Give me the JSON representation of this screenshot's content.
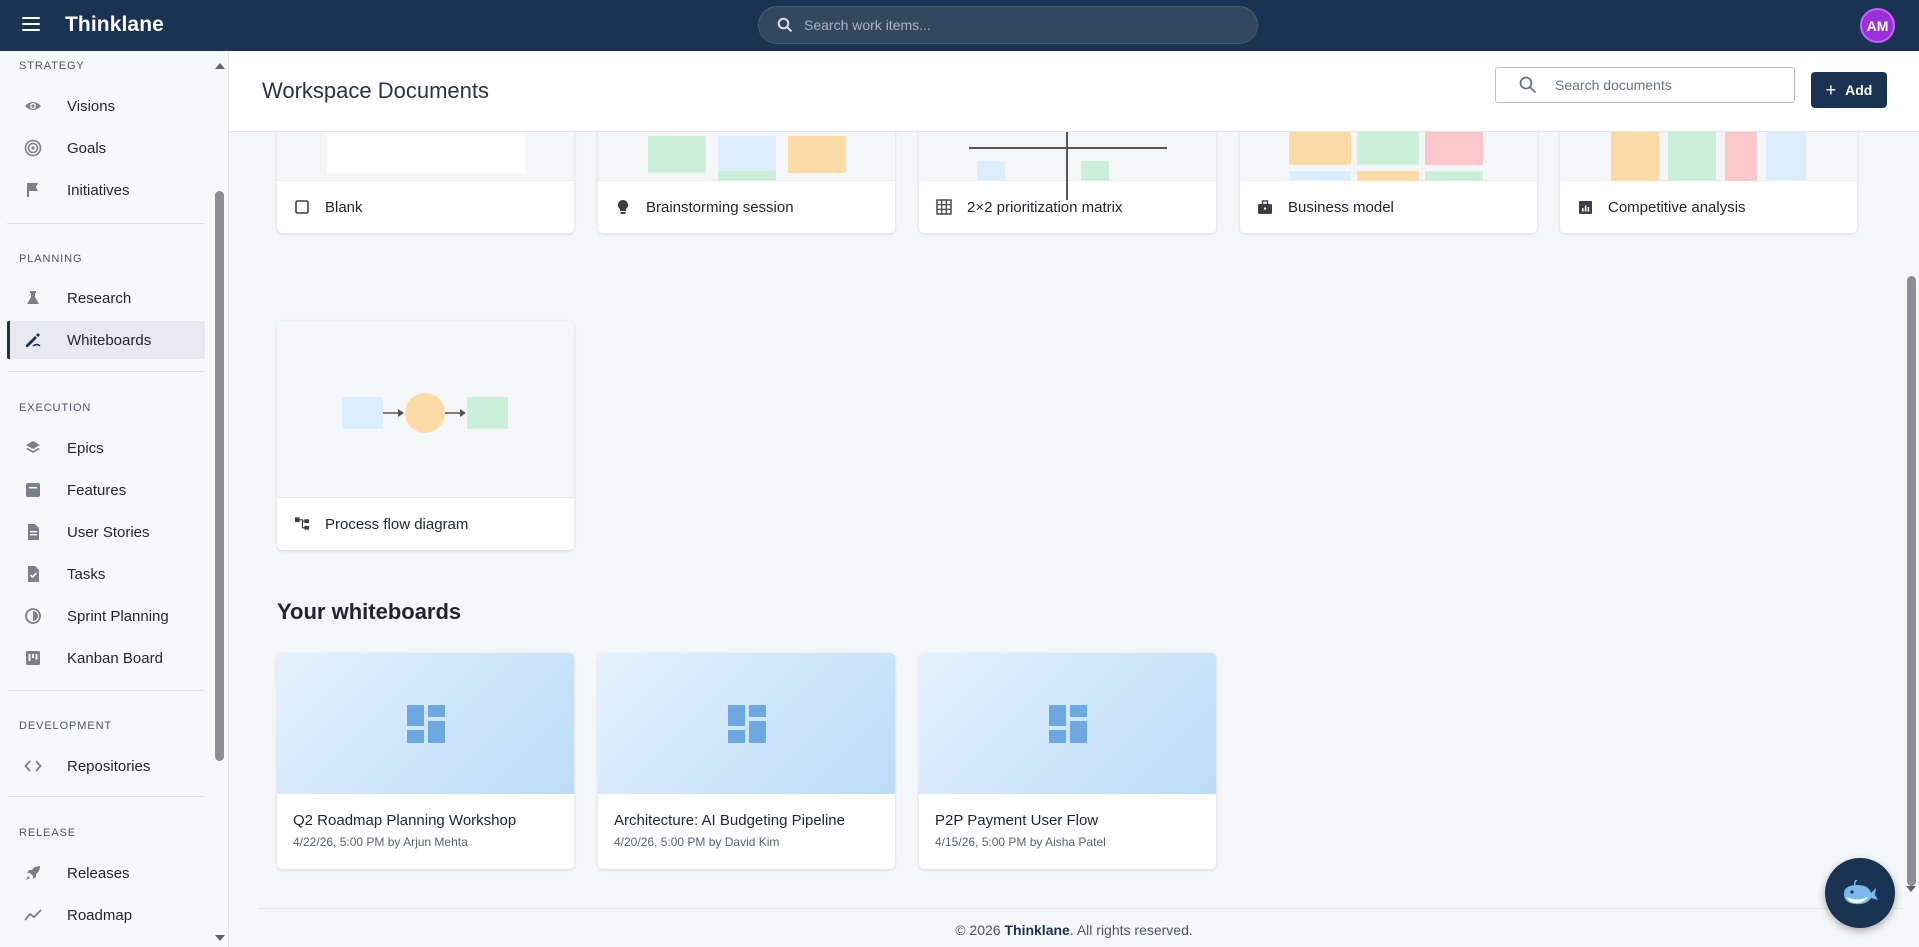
{
  "topbar": {
    "brand": "Thinklane",
    "search_placeholder": "Search work items...",
    "avatar_initials": "AM"
  },
  "sidebar": {
    "sections": [
      {
        "title": "STRATEGY",
        "items": [
          {
            "label": "Visions",
            "icon": "eye-icon"
          },
          {
            "label": "Goals",
            "icon": "target-icon"
          },
          {
            "label": "Initiatives",
            "icon": "flag-icon"
          }
        ]
      },
      {
        "title": "PLANNING",
        "items": [
          {
            "label": "Research",
            "icon": "flask-icon"
          },
          {
            "label": "Whiteboards",
            "icon": "draw-icon",
            "active": true
          }
        ]
      },
      {
        "title": "EXECUTION",
        "items": [
          {
            "label": "Epics",
            "icon": "layers-icon"
          },
          {
            "label": "Features",
            "icon": "feature-icon"
          },
          {
            "label": "User Stories",
            "icon": "document-icon"
          },
          {
            "label": "Tasks",
            "icon": "task-icon"
          },
          {
            "label": "Sprint Planning",
            "icon": "sprint-icon"
          },
          {
            "label": "Kanban Board",
            "icon": "kanban-icon"
          }
        ]
      },
      {
        "title": "DEVELOPMENT",
        "items": [
          {
            "label": "Repositories",
            "icon": "code-icon"
          }
        ]
      },
      {
        "title": "RELEASE",
        "items": [
          {
            "label": "Releases",
            "icon": "rocket-icon"
          },
          {
            "label": "Roadmap",
            "icon": "trend-icon"
          }
        ]
      }
    ]
  },
  "header": {
    "title": "Workspace Documents",
    "search_placeholder": "Search documents",
    "add_label": "Add"
  },
  "templates": [
    {
      "label": "Blank",
      "icon": "square-icon"
    },
    {
      "label": "Brainstorming session",
      "icon": "lightbulb-icon"
    },
    {
      "label": "2×2 prioritization matrix",
      "icon": "grid-icon"
    },
    {
      "label": "Business model",
      "icon": "briefcase-icon"
    },
    {
      "label": "Competitive analysis",
      "icon": "analytics-icon"
    },
    {
      "label": "Process flow diagram",
      "icon": "flow-icon"
    }
  ],
  "whiteboards": {
    "section_title": "Your whiteboards",
    "items": [
      {
        "title": "Q2 Roadmap Planning Workshop",
        "meta": "4/22/26, 5:00 PM by Arjun Mehta"
      },
      {
        "title": "Architecture: AI Budgeting Pipeline",
        "meta": "4/20/26, 5:00 PM by David Kim"
      },
      {
        "title": "P2P Payment User Flow",
        "meta": "4/15/26, 5:00 PM by Aisha Patel"
      }
    ]
  },
  "footer": {
    "prefix": "© 2026 ",
    "brand": "Thinklane",
    "suffix": ". All rights reserved."
  },
  "colors": {
    "brand_navy": "#1b3352",
    "avatar_purple": "#9b30d9",
    "sticky_green": "#ccefd9",
    "sticky_blue": "#dcedfc",
    "sticky_orange": "#fcdba6",
    "sticky_red": "#fcc7cb"
  }
}
